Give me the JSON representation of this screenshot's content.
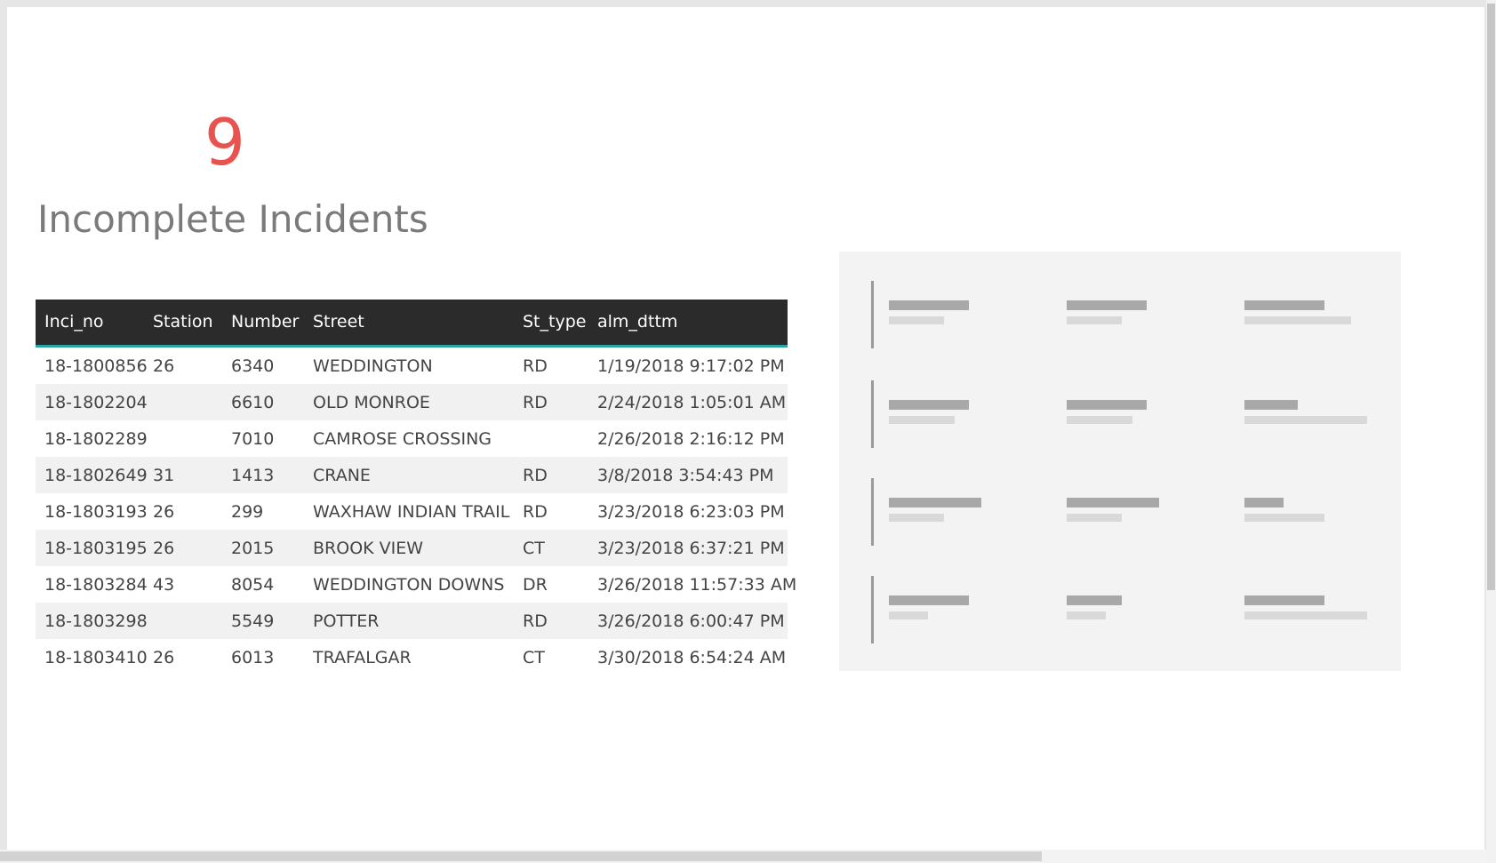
{
  "kpi": {
    "value": "9",
    "label": "Incomplete Incidents",
    "color": "#e8534f"
  },
  "table": {
    "columns": [
      "Inci_no",
      "Station",
      "Number",
      "Street",
      "St_type",
      "alm_dttm"
    ],
    "rows": [
      [
        "18-1800856",
        "26",
        "6340",
        "WEDDINGTON",
        "RD",
        "1/19/2018 9:17:02 PM"
      ],
      [
        "18-1802204",
        "",
        "6610",
        "OLD MONROE",
        "RD",
        "2/24/2018 1:05:01 AM"
      ],
      [
        "18-1802289",
        "",
        "7010",
        "CAMROSE CROSSING",
        "",
        "2/26/2018 2:16:12 PM"
      ],
      [
        "18-1802649",
        "31",
        "1413",
        "CRANE",
        "RD",
        "3/8/2018 3:54:43 PM"
      ],
      [
        "18-1803193",
        "26",
        "299",
        "WAXHAW INDIAN TRAIL",
        "RD",
        "3/23/2018 6:23:03 PM"
      ],
      [
        "18-1803195",
        "26",
        "2015",
        "BROOK VIEW",
        "CT",
        "3/23/2018 6:37:21 PM"
      ],
      [
        "18-1803284",
        "43",
        "8054",
        "WEDDINGTON DOWNS",
        "DR",
        "3/26/2018 11:57:33 AM"
      ],
      [
        "18-1803298",
        "",
        "5549",
        "POTTER",
        "RD",
        "3/26/2018 6:00:47 PM"
      ],
      [
        "18-1803410",
        "26",
        "6013",
        "TRAFALGAR",
        "CT",
        "3/30/2018 6:54:24 AM"
      ]
    ],
    "header_bg": "#2b2b2b",
    "header_accent": "#2aa3a3"
  },
  "placeholder_visual": {
    "icon": "multi-row-card-placeholder",
    "background": "#f3f3f3"
  }
}
